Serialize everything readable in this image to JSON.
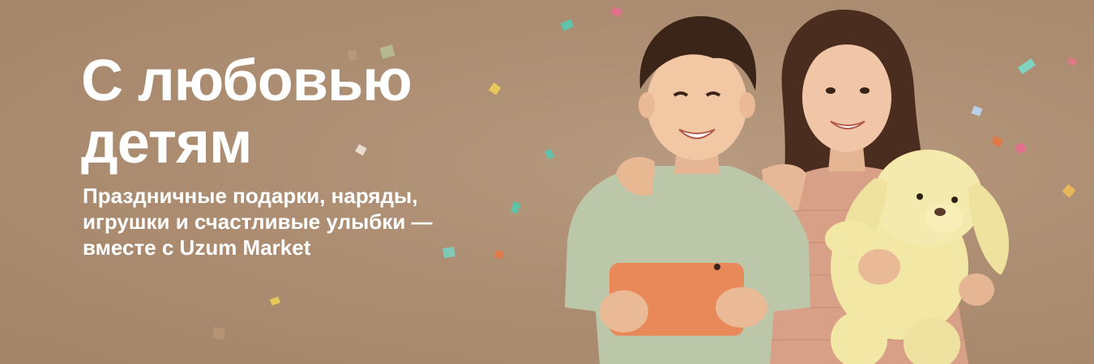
{
  "banner": {
    "headline_line1": "С любовью",
    "headline_line2": "детям",
    "subtitle_line1": "Праздничные подарки, наряды,",
    "subtitle_line2": "игрушки и счастливые улыбки —",
    "subtitle_line3": "вместе с Uzum Market"
  },
  "colors": {
    "background": "#ad8e73",
    "text": "#ffffff",
    "tablet": "#e9895a",
    "plush": "#f3e7a6",
    "boy_shirt": "#bcc7a9",
    "girl_dress": "#dba38a"
  },
  "images": {
    "children_photo": "photo of a smiling boy holding an orange tablet and a girl hugging a yellow plush bunny",
    "confetti": "confetti-decoration"
  }
}
